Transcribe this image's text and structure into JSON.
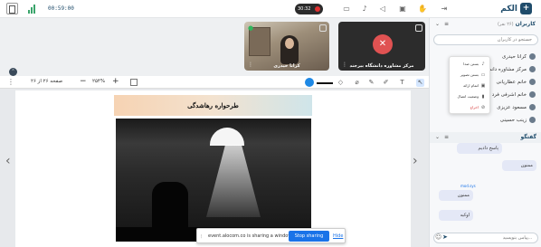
{
  "app": {
    "name": "الكم",
    "timer": "00:59:00",
    "record_time": "30:32"
  },
  "topbar": {
    "icons": [
      "layout-icon",
      "signal-icon",
      "record-icon",
      "camera-off-icon",
      "mic-off-icon",
      "volume-icon",
      "screen-share-icon",
      "hand-icon",
      "exit-icon"
    ]
  },
  "tiles": [
    {
      "label": "کرانا حیدری",
      "mic": "on"
    },
    {
      "label": "مرکز مشاوره دانشگاه بیرجند",
      "mic": "off"
    }
  ],
  "toolbar": {
    "page_info": "صفحه ۲۶ از ۲۶",
    "zoom": "۲۵۴%",
    "tools": [
      "pointer-tool-icon",
      "text-tool-icon",
      "pen-tool-icon",
      "highlighter-tool-icon",
      "marker-tool-icon",
      "eraser-tool-icon",
      "line-tool-icon",
      "color-picker"
    ]
  },
  "slide": {
    "title": "طرحواره رهاشدگی"
  },
  "share_bar": {
    "message": "event.alocom.co is sharing a window.",
    "stop_label": "Stop sharing",
    "hide_label": "Hide"
  },
  "users_panel": {
    "title": "کاربران",
    "count": "(۲۶ نفر)",
    "search_placeholder": "جستجو در کاربران",
    "users": [
      "کرانا حیدری",
      "مرکز مشاوره دانشگاه",
      "خانم عطاریانی",
      "خانم اشرفی فرد",
      "مسعود عزیزی",
      "زینب حسینی"
    ]
  },
  "context_menu": {
    "items": [
      {
        "label": "بستن صدا",
        "icon": "mic-icon"
      },
      {
        "label": "بستن تصویر",
        "icon": "camera-icon"
      },
      {
        "label": "اتمام ارائه",
        "icon": "presentation-icon"
      },
      {
        "label": "وضعیت اتصال",
        "icon": "signal-icon"
      },
      {
        "label": "اخراج",
        "icon": "kick-icon"
      }
    ]
  },
  "chat": {
    "title": "گفتگو",
    "input_placeholder": "پیامی بنویسید...",
    "messages": [
      {
        "text": "پاسخ دادیم",
        "time": "",
        "side": "right"
      },
      {
        "text": "ممنون",
        "time": "",
        "side": "left"
      },
      {
        "sender": "mod.sys",
        "text": "ممنون",
        "time": "",
        "side": "right"
      },
      {
        "text": "اوکیه",
        "time": "",
        "side": "right"
      }
    ]
  }
}
